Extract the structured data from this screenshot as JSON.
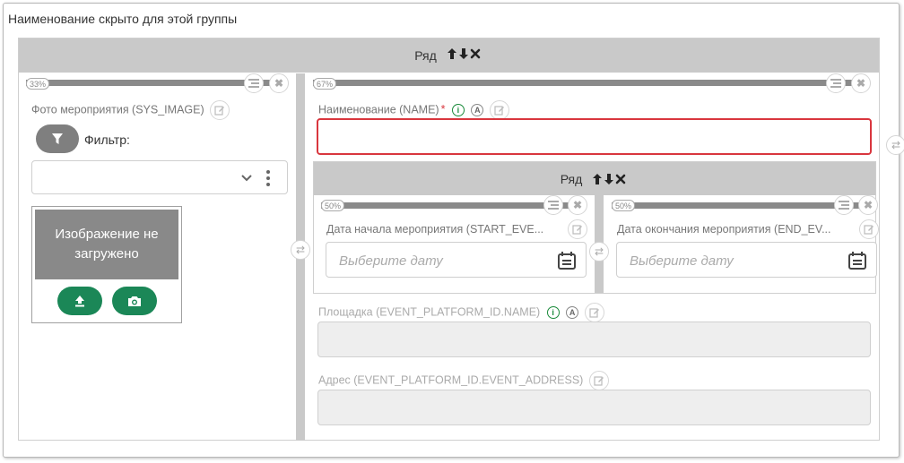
{
  "group_title": "Наименование скрыто для этой группы",
  "row": {
    "label": "Ряд",
    "controls": "🡅🡇✖"
  },
  "nested_row": {
    "label": "Ряд",
    "controls": "🡅🡇✖"
  },
  "left_column": {
    "width_badge": "33%",
    "photo_label": "Фото мероприятия (SYS_IMAGE)",
    "filter_label": "Фильтр:",
    "image_placeholder": "Изображение не загружено"
  },
  "right_column": {
    "width_badge": "67%",
    "name_label": "Наименование (NAME)",
    "required_mark": "*",
    "info_icon_letter": "i",
    "auto_icon_letter": "A",
    "start_date": {
      "width_badge": "50%",
      "label": "Дата начала мероприятия (START_EVE...",
      "placeholder": "Выберите дату"
    },
    "end_date": {
      "width_badge": "50%",
      "label": "Дата окончания мероприятия (END_EV...",
      "placeholder": "Выберите дату"
    },
    "platform_label": "Площадка (EVENT_PLATFORM_ID.NAME)",
    "address_label": "Адрес (EVENT_PLATFORM_ID.EVENT_ADDRESS)"
  },
  "colors": {
    "required_border": "#d9363e",
    "accent_green": "#1b8757",
    "info_green": "#1a8a3a",
    "header_grey": "#c9c9c9"
  }
}
